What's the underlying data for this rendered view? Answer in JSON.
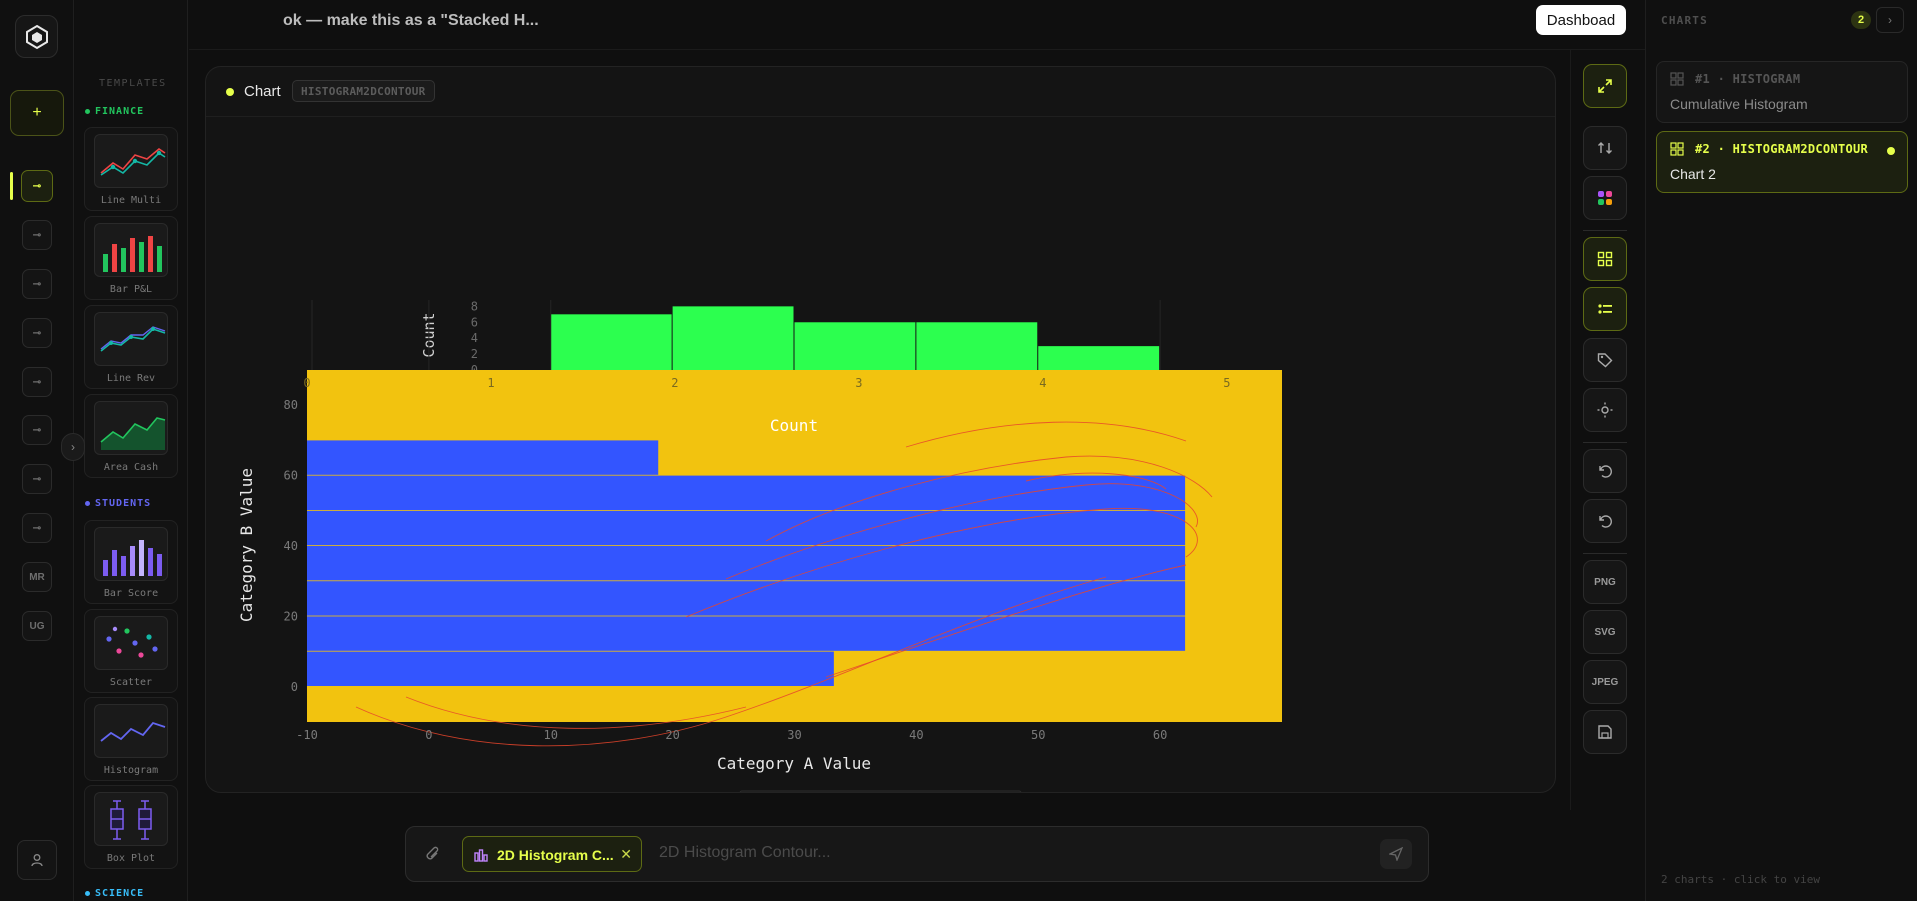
{
  "topbar": {
    "prompt_title": "ok — make this as a \"Stacked H...",
    "dashboard_label": "Dashboad"
  },
  "rail": {
    "items": [
      "MR",
      "UG"
    ]
  },
  "templates": {
    "title": "TEMPLATES",
    "sections": [
      {
        "name": "FINANCE",
        "color": "#22c55e",
        "items": [
          "Line Multi",
          "Bar P&L",
          "Line Rev",
          "Area Cash"
        ]
      },
      {
        "name": "STUDENTS",
        "color": "#6366f1",
        "items": [
          "Bar Score",
          "Scatter",
          "Histogram",
          "Box Plot"
        ]
      },
      {
        "name": "SCIENCE",
        "color": "#38bdf8",
        "items": []
      }
    ]
  },
  "chart_panel": {
    "label": "Chart",
    "type_badge": "HISTOGRAM2DCONTOUR"
  },
  "toolbar": {
    "png": "PNG",
    "svg": "SVG",
    "jpeg": "JPEG"
  },
  "input": {
    "chip_label": "2D Histogram C...",
    "placeholder": "2D Histogram Contour..."
  },
  "charts_sidebar": {
    "title": "CHARTS",
    "count": "2",
    "cards": [
      {
        "kicker": "#1 · HISTOGRAM",
        "name": "Cumulative Histogram"
      },
      {
        "kicker": "#2 · HISTOGRAM2DCONTOUR",
        "name": "Chart 2"
      }
    ],
    "footer": "2 charts · click to view"
  },
  "chart_data": {
    "type": "bar",
    "xlabel": "Category A Value",
    "ylabel": "Category B Value",
    "top_axis_label": "Count",
    "inner_label": "Count",
    "xlim": [
      -10,
      70
    ],
    "ylim": [
      -10,
      90
    ],
    "x_ticks": [
      "-10",
      "0",
      "10",
      "20",
      "30",
      "40",
      "50",
      "60"
    ],
    "y_ticks": [
      "0",
      "20",
      "40",
      "60",
      "80"
    ],
    "top_count_ticks": [
      "0",
      "1",
      "2",
      "3",
      "4",
      "5"
    ],
    "top_y_ticks": [
      "0",
      "2",
      "4",
      "6",
      "8"
    ],
    "top_histogram": [
      {
        "x0": 10,
        "x1": 20,
        "count": 7
      },
      {
        "x0": 20,
        "x1": 30,
        "count": 8
      },
      {
        "x0": 30,
        "x1": 40,
        "count": 6
      },
      {
        "x0": 40,
        "x1": 50,
        "count": 6
      },
      {
        "x0": 50,
        "x1": 60,
        "count": 3
      }
    ],
    "right_histogram": [
      {
        "y0": 0,
        "y1": 10,
        "count": 3
      },
      {
        "y0": 10,
        "y1": 20,
        "count": 5
      },
      {
        "y0": 20,
        "y1": 30,
        "count": 5
      },
      {
        "y0": 30,
        "y1": 40,
        "count": 5
      },
      {
        "y0": 40,
        "y1": 50,
        "count": 5
      },
      {
        "y0": 50,
        "y1": 60,
        "count": 5
      },
      {
        "y0": 60,
        "y1": 70,
        "count": 2
      }
    ],
    "series": [
      {
        "name": "Category A",
        "color": "#2cff4f"
      },
      {
        "name": "Category B",
        "color": "#3355ff"
      }
    ],
    "plot_bg": "#f2c30f",
    "contour_color": "#e8452c"
  }
}
